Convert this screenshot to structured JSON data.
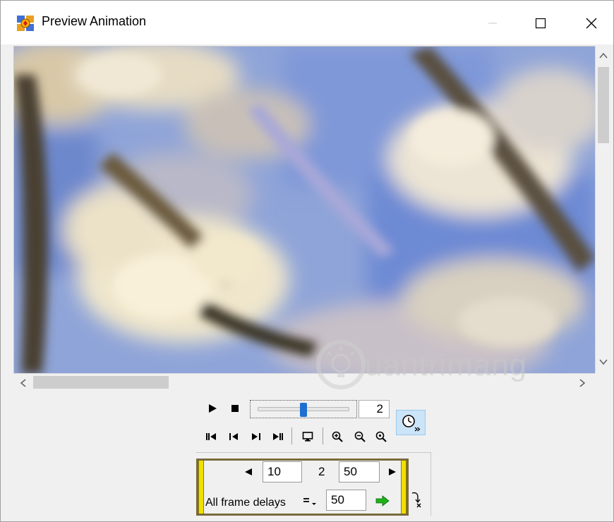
{
  "window": {
    "title": "Preview Animation",
    "icon": "animation-app-icon"
  },
  "titlebar_controls": [
    "minimize-icon",
    "maximize-icon",
    "close-icon"
  ],
  "preview": {
    "image": "blurred cherry blossom photo"
  },
  "watermark": {
    "text": "uantrimang"
  },
  "playback": {
    "play_icon": "play-icon",
    "stop_icon": "stop-icon",
    "slider_position": 0.5,
    "current_frame": "2"
  },
  "navigation_icons": [
    "first-frame-icon",
    "previous-frame-icon",
    "next-frame-icon",
    "last-frame-icon",
    "monitor-icon",
    "zoom-in-icon",
    "zoom-out-icon",
    "zoom-actual-icon"
  ],
  "timing_panel": {
    "prev_value": "10",
    "frame_number": "2",
    "next_value": "50",
    "all_frame_delays_label": "All frame delays",
    "delay_value": "50"
  },
  "colors": {
    "slider_thumb": "#1e6fd1",
    "panel_highlight": "#f0e000",
    "apply_arrow": "#1db318",
    "timer_button": "#cce4f7"
  }
}
